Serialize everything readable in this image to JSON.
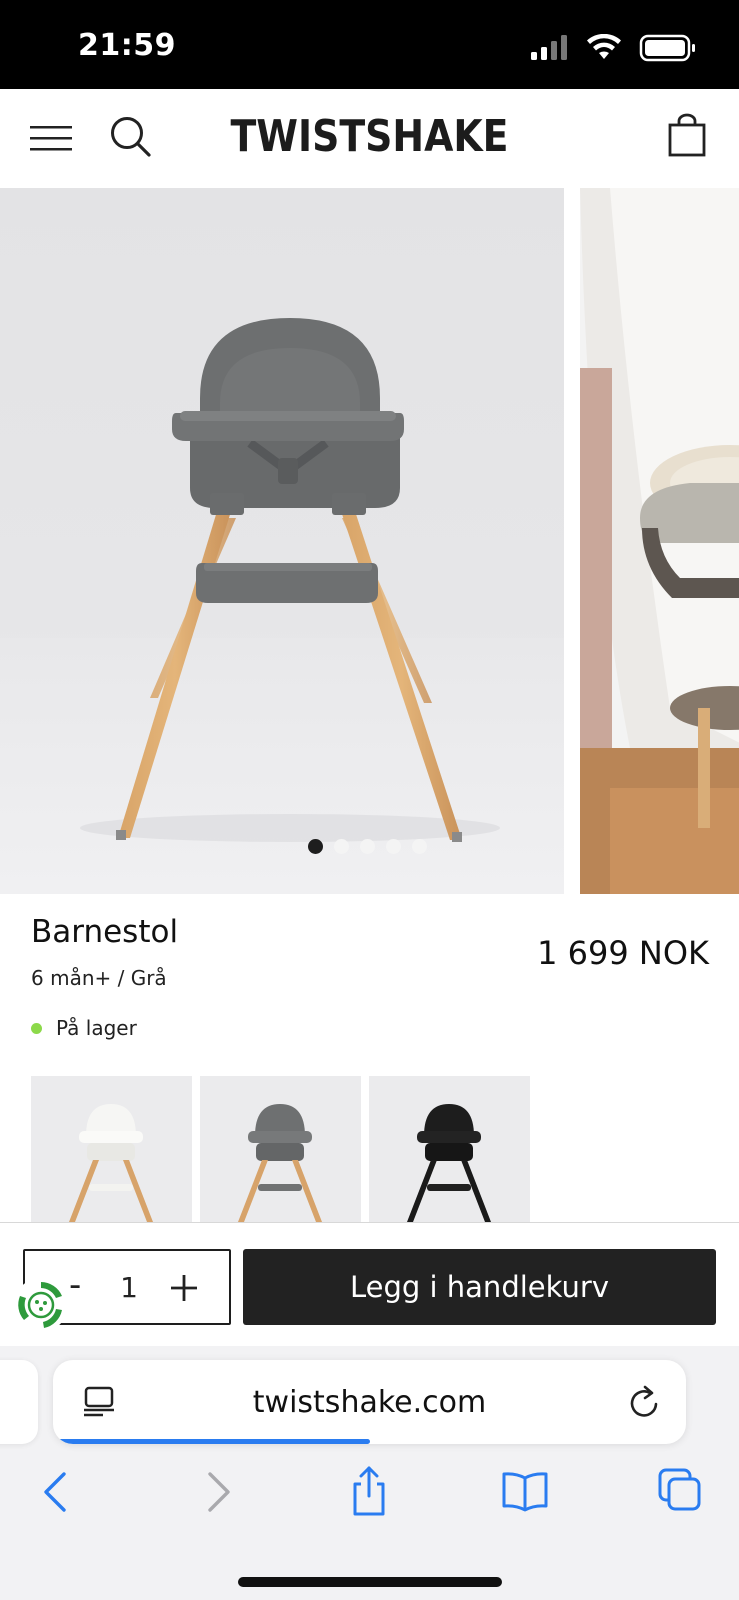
{
  "status_bar": {
    "time": "21:59",
    "icons": [
      "signal-icon",
      "wifi-icon",
      "battery-icon"
    ]
  },
  "header": {
    "logo": "TWISTSHAKE",
    "icons": [
      "menu-icon",
      "search-icon",
      "cart-icon"
    ]
  },
  "gallery": {
    "slide_count": 5,
    "active_slide": 1,
    "slides": [
      "high-chair-grey",
      "high-chair-lifestyle"
    ]
  },
  "product": {
    "title": "Barnestol",
    "variant": "6 mån+ / Grå",
    "price": "1 699 NOK",
    "stock_status": "På lager",
    "stock_color": "#8cd94a",
    "color_options": [
      "white",
      "grey",
      "black"
    ]
  },
  "purchase": {
    "minus_label": "-",
    "quantity": "1",
    "add_to_cart_label": "Legg i handlekurv",
    "button_color": "#222222"
  },
  "browser": {
    "url": "twistshake.com",
    "load_progress": 0.5,
    "accent_color": "#2a7cf0",
    "toolbar_icons": [
      "back-icon",
      "forward-icon",
      "share-icon",
      "bookmarks-icon",
      "tabs-icon"
    ]
  }
}
